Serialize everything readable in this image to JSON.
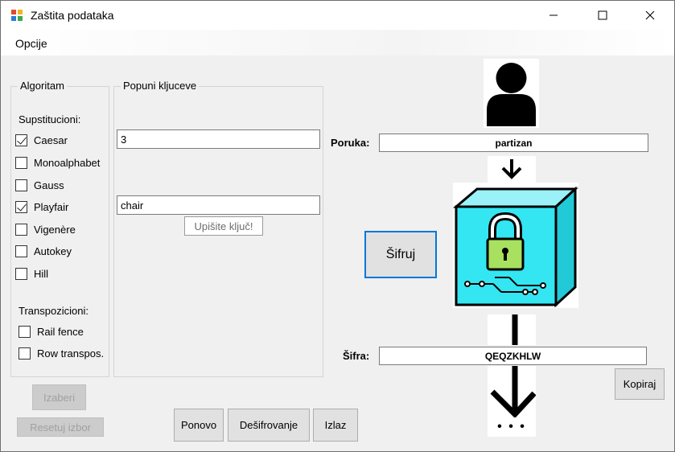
{
  "window": {
    "title": "Zaštita podataka"
  },
  "menu": {
    "items": [
      {
        "label": "Opcije"
      }
    ]
  },
  "algorithm_group": {
    "title": "Algoritam",
    "substitution_label": "Supstitucioni:",
    "substitution": [
      {
        "label": "Caesar",
        "checked": true
      },
      {
        "label": "Monoalphabet",
        "checked": false
      },
      {
        "label": "Gauss",
        "checked": false
      },
      {
        "label": "Playfair",
        "checked": true
      },
      {
        "label": "Vigenère",
        "checked": false
      },
      {
        "label": "Autokey",
        "checked": false
      },
      {
        "label": "Hill",
        "checked": false
      }
    ],
    "transposition_label": "Transpozicioni:",
    "transposition": [
      {
        "label": "Rail fence",
        "checked": false
      },
      {
        "label": "Row transpos.",
        "checked": false
      }
    ]
  },
  "keys_group": {
    "title": "Popuni kljuceve",
    "caesar_key": "3",
    "playfair_key": "chair",
    "hint": "Upišite ključ!"
  },
  "buttons": {
    "izaberi": "Izaberi",
    "resetuj": "Resetuj izbor",
    "ponovo": "Ponovo",
    "desifrovanje": "Dešifrovanje",
    "izlaz": "Izlaz",
    "sifruj": "Šifruj",
    "kopiraj": "Kopiraj"
  },
  "message": {
    "label": "Poruka:",
    "value": "partizan"
  },
  "cipher": {
    "label": "Šifra:",
    "value": "QEQZKHLW"
  },
  "graphics": {
    "dots": "• • •"
  },
  "colors": {
    "accent": "#0078d7",
    "cube_cyan": "#33e6f2",
    "lock_green": "#a8e05f"
  }
}
